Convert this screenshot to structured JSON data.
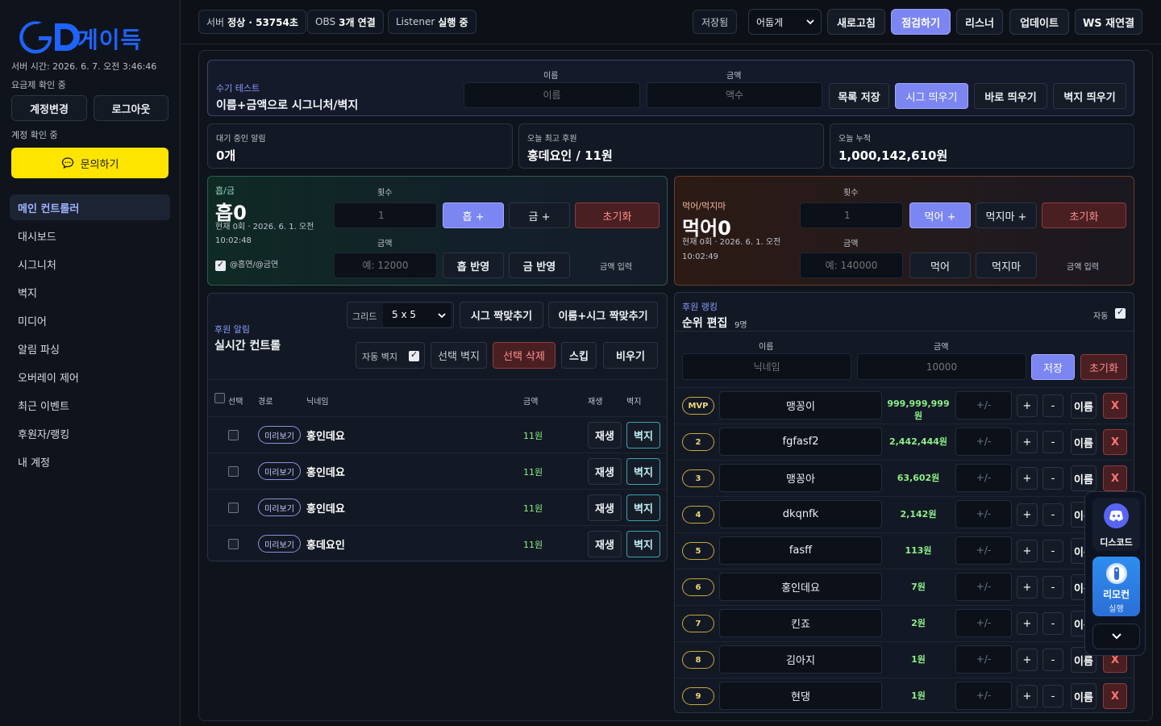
{
  "sidebar": {
    "logo_text": "게이득",
    "server_time": "서버 시간: 2026. 6. 7. 오전 3:46:46",
    "plan_status": "요금제 확인 중",
    "account_change": "계정변경",
    "logout": "로그아웃",
    "account_status": "계정 확인 중",
    "inquiry": "문의하기",
    "nav": [
      "메인 컨트롤러",
      "대시보드",
      "시그니처",
      "벽지",
      "미디어",
      "알림 파싱",
      "오버레이 제어",
      "최근 이벤트",
      "후원자/랭킹",
      "내 계정"
    ]
  },
  "topbar": {
    "server_label": "서버",
    "server_value": "정상 · 53754초",
    "obs_label": "OBS",
    "obs_value": "3개 연결",
    "listener_label": "Listener",
    "listener_value": "실행 중",
    "saved": "저장됨",
    "theme_selected": "어둡게",
    "refresh": "새로고침",
    "inspect": "점검하기",
    "listener_btn": "리스너",
    "update": "업데이트",
    "ws_reconnect": "WS 재연결"
  },
  "manual": {
    "tag": "수기 테스트",
    "title": "이름+금액으로 시그니처/벽지",
    "name_label": "이름",
    "name_placeholder": "이름",
    "amount_label": "금액",
    "amount_placeholder": "액수",
    "save_list": "목록 저장",
    "sig_pop": "시그 띄우기",
    "direct_pop": "바로 띄우기",
    "wall_pop": "벽지 띄우기"
  },
  "stats": {
    "pending_label": "대기 중인 알림",
    "pending_value": "0개",
    "top_label": "오늘 최고 후원",
    "top_value": "홍데요인 / 11원",
    "total_label": "오늘 누적",
    "total_value": "1,000,142,610원"
  },
  "heum": {
    "tag": "흡/금",
    "counter": "흡0",
    "meta1": "현재 0회 · 2026. 6. 1. 오전",
    "meta2": "10:02:48",
    "count_label": "횟수",
    "count_placeholder": "1",
    "heum_plus": "흡 +",
    "geum_plus": "금 +",
    "reset": "초기화",
    "amount_label": "금액",
    "amount_placeholder": "예: 12000",
    "heum_apply": "흡 반영",
    "geum_apply": "금 반영",
    "amount_input": "금액 입력",
    "mention": "@흡연/@금연"
  },
  "meok": {
    "tag": "먹어/먹지마",
    "counter": "먹어0",
    "meta1": "현재 0회 · 2026. 6. 1. 오전",
    "meta2": "10:02:49",
    "count_label": "횟수",
    "count_placeholder": "1",
    "meok_plus": "먹어 +",
    "meokjima_plus": "먹지마 +",
    "reset": "초기화",
    "amount_label": "금액",
    "amount_placeholder": "예: 140000",
    "meok": "먹어",
    "meokjima": "먹지마",
    "amount_input": "금액 입력"
  },
  "alerts": {
    "tag": "후원 알림",
    "title": "실시간 컨트롤",
    "grid_label": "그리드",
    "grid_value": "5 x 5",
    "sig_match": "시그 짝맞추기",
    "name_sig_match": "이름+시그 짝맞추기",
    "auto_wall": "자동 벽지",
    "select_wall": "선택 벽지",
    "select_delete": "선택 삭제",
    "skip": "스킵",
    "clear": "비우기",
    "headers": [
      "선택",
      "경로",
      "닉네임",
      "금액",
      "재생",
      "벽지"
    ],
    "rows": [
      {
        "route": "미리보기",
        "nick": "홍인데요",
        "amount": "11원",
        "play": "재생",
        "wall": "벽지"
      },
      {
        "route": "미리보기",
        "nick": "홍인데요",
        "amount": "11원",
        "play": "재생",
        "wall": "벽지"
      },
      {
        "route": "미리보기",
        "nick": "홍인데요",
        "amount": "11원",
        "play": "재생",
        "wall": "벽지"
      },
      {
        "route": "미리보기",
        "nick": "홍데요인",
        "amount": "11원",
        "play": "재생",
        "wall": "벽지"
      }
    ]
  },
  "ranking": {
    "tag": "후원 랭킹",
    "title": "순위 편집",
    "count": "9명",
    "auto": "자동",
    "name_label": "이름",
    "name_placeholder": "닉네임",
    "amount_label": "금액",
    "amount_placeholder": "10000",
    "save": "저장",
    "reset": "초기화",
    "delta_placeholder": "+/-",
    "plus": "+",
    "minus": "-",
    "name_btn": "이름",
    "x": "X",
    "rows": [
      {
        "rank": "MVP",
        "name": "맹꽁이",
        "amount": "999,999,999원"
      },
      {
        "rank": "2",
        "name": "fgfasf2",
        "amount": "2,442,444원"
      },
      {
        "rank": "3",
        "name": "맹꽁아",
        "amount": "63,602원"
      },
      {
        "rank": "4",
        "name": "dkqnfk",
        "amount": "2,142원"
      },
      {
        "rank": "5",
        "name": "fasff",
        "amount": "113원"
      },
      {
        "rank": "6",
        "name": "홍인데요",
        "amount": "7원"
      },
      {
        "rank": "7",
        "name": "킨죠",
        "amount": "2원"
      },
      {
        "rank": "8",
        "name": "김아지",
        "amount": "1원"
      },
      {
        "rank": "9",
        "name": "현댕",
        "amount": "1원"
      }
    ]
  },
  "float": {
    "discord": "디스코드",
    "remote": "리모컨",
    "remote_sub": "실행"
  },
  "colors": {
    "accent": "#7b86f2",
    "brand_blue": "#1f63ff",
    "kakao": "#fee500",
    "danger": "#ff7474",
    "amount_green": "#8cf08a"
  }
}
